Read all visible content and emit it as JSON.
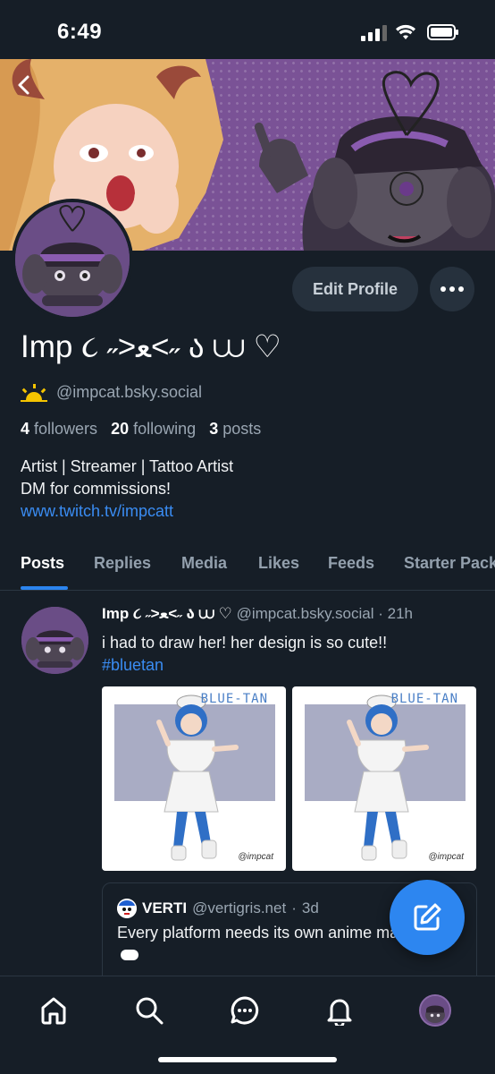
{
  "status_bar": {
    "time": "6:49"
  },
  "profile": {
    "display_name": "Imp ૮ ˶>ﻌ<˶ ა ⩊ ♡",
    "handle": "@impcat.bsky.social",
    "stats": {
      "followers_count": "4",
      "followers_label": "followers",
      "following_count": "20",
      "following_label": "following",
      "posts_count": "3",
      "posts_label": "posts"
    },
    "bio_lines": [
      "Artist | Streamer | Tattoo Artist",
      "DM for commissions!"
    ],
    "bio_link": "www.twitch.tv/impcatt",
    "edit_button": "Edit Profile"
  },
  "tabs": [
    "Posts",
    "Replies",
    "Media",
    "Likes",
    "Feeds",
    "Starter Packs"
  ],
  "active_tab": "Posts",
  "post": {
    "author_name": "Imp ૮ ˶>ﻌ<˶ ა ⩊ ♡",
    "author_handle": "@impcat.bsky.social",
    "time": "21h",
    "text": "i had to draw her! her design is so cute!!",
    "hashtag": "#bluetan",
    "images": [
      {
        "title": "BLUE-TAN",
        "signature": "@impcat"
      },
      {
        "title": "BLUE-TAN",
        "signature": "@impcat"
      }
    ],
    "quote": {
      "author_name": "VERTI",
      "author_handle": "@vertigris.net",
      "time": "3d",
      "text": "Every platform needs its own anime mascot!"
    }
  },
  "icons": {
    "back": "chevron-left-icon",
    "more": "ellipsis-icon",
    "sun": "sunrise-icon",
    "compose": "pencil-icon",
    "nav": [
      "home-icon",
      "search-icon",
      "chat-icon",
      "bell-icon",
      "avatar"
    ]
  },
  "colors": {
    "background": "#161e27",
    "accent": "#2b84ee",
    "link": "#3a8cf2",
    "banner": "#7a5296"
  }
}
